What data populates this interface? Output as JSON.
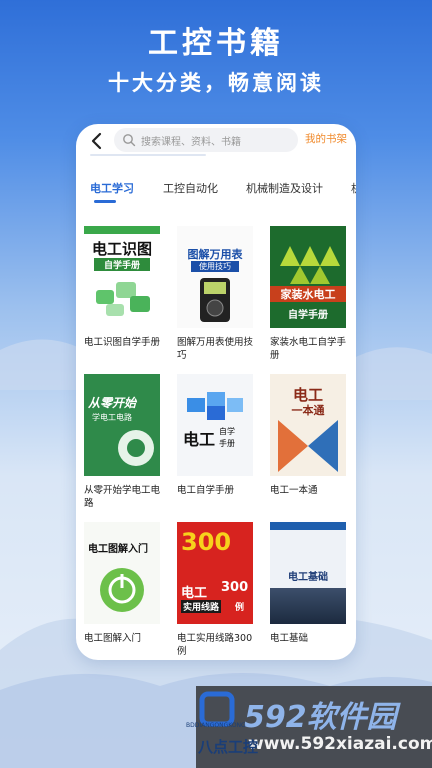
{
  "hero": {
    "title": "工控书籍",
    "subtitle": "十大分类，畅意阅读"
  },
  "search": {
    "placeholder": "搜索课程、资料、书籍",
    "shelf_label": "我的书架"
  },
  "tabs": [
    {
      "label": "电工学习",
      "active": true
    },
    {
      "label": "工控自动化",
      "active": false
    },
    {
      "label": "机械制造及设计",
      "active": false
    },
    {
      "label": "机",
      "active": false
    }
  ],
  "books": [
    {
      "title": "电工识图自学手册",
      "cover_text": [
        "电工识图",
        "自学手册"
      ]
    },
    {
      "title": "图解万用表使用技巧",
      "cover_text": [
        "图解万用表",
        "使用技巧"
      ]
    },
    {
      "title": "家装水电工自学手册",
      "cover_text": [
        "家装水电工",
        "自学手册"
      ]
    },
    {
      "title": "从零开始学电工电路",
      "cover_text": [
        "从零开始",
        "学电工电路"
      ]
    },
    {
      "title": "电工自学手册",
      "cover_text": [
        "电工",
        "自学",
        "手册"
      ]
    },
    {
      "title": "电工一本通",
      "cover_text": [
        "电工",
        "一本通"
      ]
    },
    {
      "title": "电工图解入门",
      "cover_text": [
        "电工图解入门"
      ]
    },
    {
      "title": "电工实用线路300例",
      "cover_text": [
        "300",
        "电工",
        "实用线路",
        "300",
        "例"
      ]
    },
    {
      "title": "电工基础",
      "cover_text": [
        "电工基础"
      ]
    }
  ],
  "watermark": {
    "brand": "592软件园",
    "url": "www.592xiazai.com",
    "app_brand": "八点工控",
    "app_brand_sub": "BDDIANGONGKONG"
  },
  "colors": {
    "accent": "#2a6bd6",
    "shelf": "#f08a2c"
  }
}
